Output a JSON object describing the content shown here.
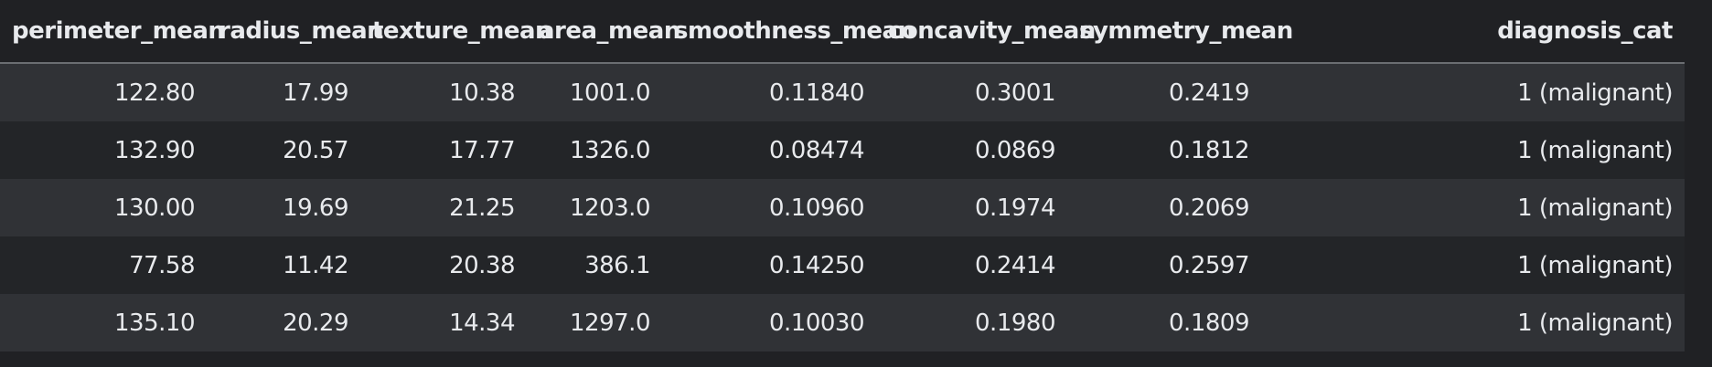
{
  "table": {
    "columns": [
      "perimeter_mean",
      "radius_mean",
      "texture_mean",
      "area_mean",
      "smoothness_mean",
      "concavity_mean",
      "symmetry_mean",
      "diagnosis_cat"
    ],
    "rows": [
      [
        "122.80",
        "17.99",
        "10.38",
        "1001.0",
        "0.11840",
        "0.3001",
        "0.2419",
        "1 (malignant)"
      ],
      [
        "132.90",
        "20.57",
        "17.77",
        "1326.0",
        "0.08474",
        "0.0869",
        "0.1812",
        "1 (malignant)"
      ],
      [
        "130.00",
        "19.69",
        "21.25",
        "1203.0",
        "0.10960",
        "0.1974",
        "0.2069",
        "1 (malignant)"
      ],
      [
        "77.58",
        "11.42",
        "20.38",
        "386.1",
        "0.14250",
        "0.2414",
        "0.2597",
        "1 (malignant)"
      ],
      [
        "135.10",
        "20.29",
        "14.34",
        "1297.0",
        "0.10030",
        "0.1980",
        "0.1809",
        "1 (malignant)"
      ]
    ]
  },
  "colors": {
    "background": "#202124",
    "row_striped": "#303236",
    "row_plain": "#232528",
    "text": "#e8eaed",
    "header_rule": "#6b6e72"
  }
}
